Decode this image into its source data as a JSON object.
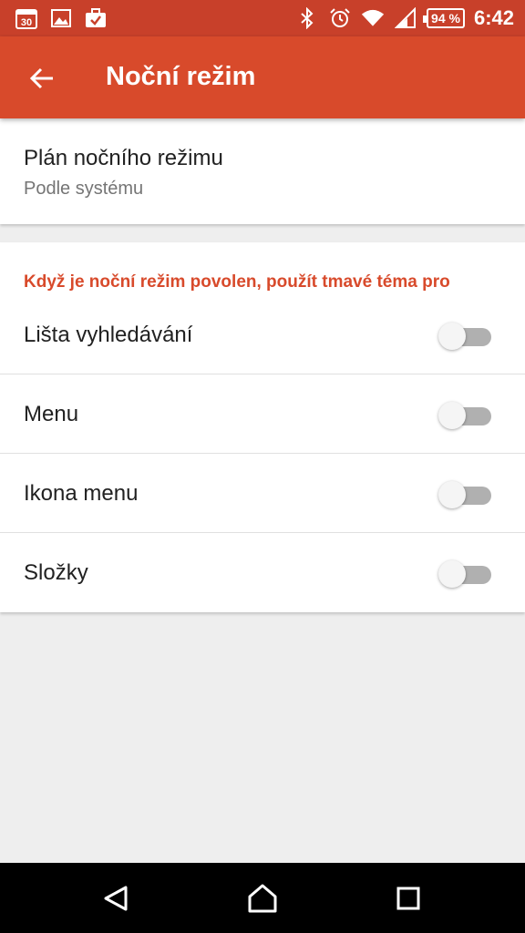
{
  "status_bar": {
    "calendar_day": "30",
    "battery_percent": "94 %",
    "time": "6:42",
    "icons": [
      "calendar-icon",
      "image-icon",
      "briefcase-check-icon",
      "bluetooth-icon",
      "alarm-icon",
      "wifi-icon",
      "signal-icon",
      "battery-icon"
    ]
  },
  "app_bar": {
    "title": "Noční režim",
    "back_icon": "arrow-back-icon",
    "color": "#d84a2b"
  },
  "plan": {
    "title": "Plán nočního režimu",
    "value": "Podle systému"
  },
  "dark_theme_section": {
    "header": "Když je noční režim povolen, použít tmavé téma pro",
    "items": [
      {
        "label": "Lišta vyhledávání",
        "enabled": false
      },
      {
        "label": "Menu",
        "enabled": false
      },
      {
        "label": "Ikona menu",
        "enabled": false
      },
      {
        "label": "Složky",
        "enabled": false
      }
    ]
  },
  "nav_bar": {
    "buttons": [
      "back-triangle-icon",
      "home-icon",
      "recents-icon"
    ]
  }
}
